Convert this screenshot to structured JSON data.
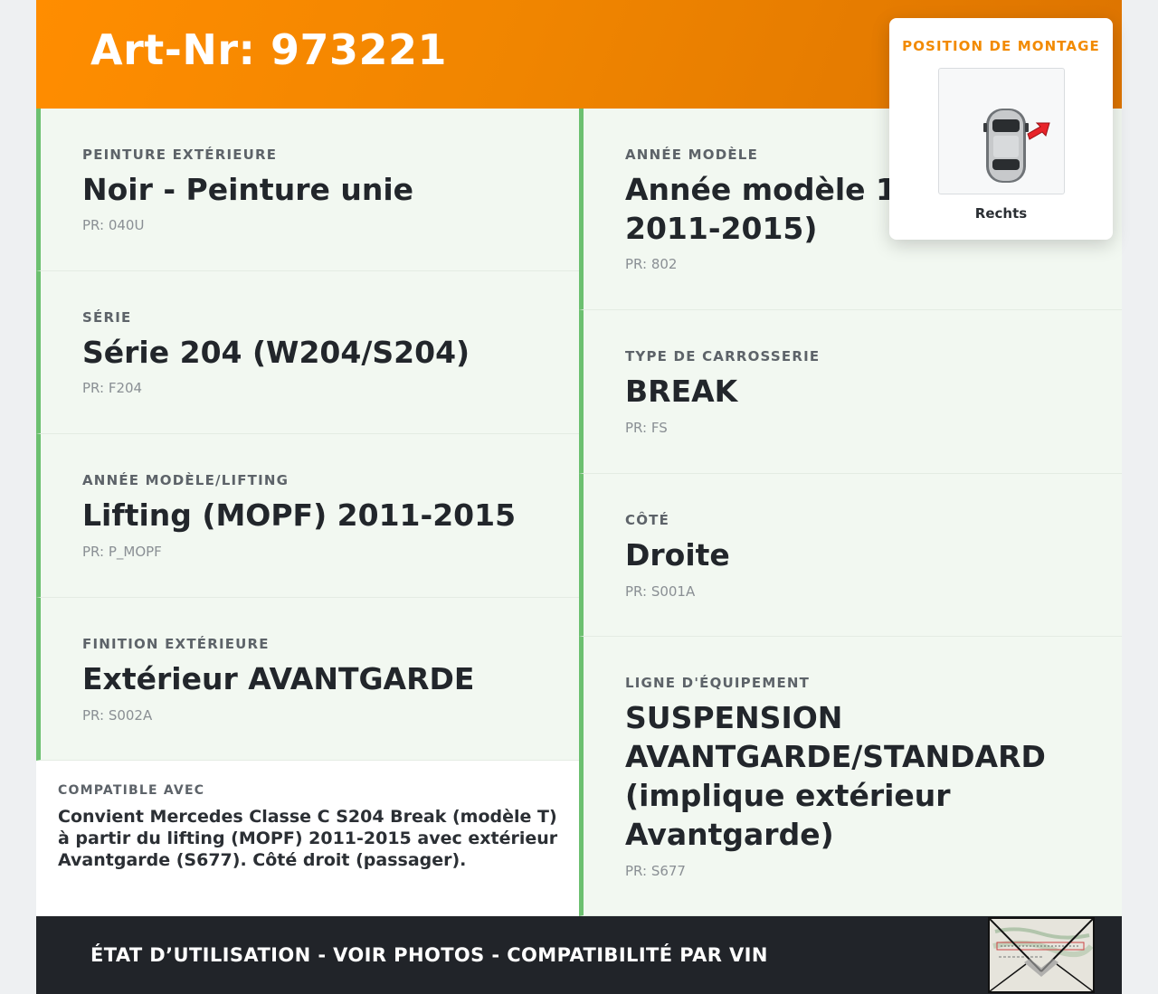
{
  "header": {
    "title": "Art-Nr: 973221"
  },
  "left_cells": [
    {
      "label": "PEINTURE EXTÉRIEURE",
      "value": "Noir - Peinture unie",
      "code": "PR: 040U"
    },
    {
      "label": "SÉRIE",
      "value": "Série 204 (W204/S204)",
      "code": "PR: F204"
    },
    {
      "label": "ANNÉE MODÈLE/LIFTING",
      "value": "Lifting (MOPF) 2011-2015",
      "code": "PR: P_MOPF"
    },
    {
      "label": "FINITION EXTÉRIEURE",
      "value": "Extérieur AVANTGARDE",
      "code": "PR: S002A"
    }
  ],
  "right_cells": [
    {
      "label": "ANNÉE MODÈLE",
      "value": "Année modèle 11/ 2011-2015)",
      "code": "PR: 802"
    },
    {
      "label": "TYPE DE CARROSSERIE",
      "value": "BREAK",
      "code": "PR: FS"
    },
    {
      "label": "CÔTÉ",
      "value": "Droite",
      "code": "PR: S001A"
    },
    {
      "label": "LIGNE D'ÉQUIPEMENT",
      "value": "SUSPENSION AVANTGARDE/STANDARD (implique extérieur Avantgarde)",
      "code": "PR: S677"
    }
  ],
  "compat": {
    "label": "COMPATIBLE AVEC",
    "text": "Convient Mercedes Classe C S204 Break (modèle T) à partir du lifting (MOPF) 2011-2015 avec extérieur Avantgarde (S677). Côté droit (passager)."
  },
  "footer": {
    "text": "ÉTAT D’UTILISATION - VOIR PHOTOS - COMPATIBILITÉ PAR VIN"
  },
  "mount": {
    "title": "POSITION DE MONTAGE",
    "caption": "Rechts"
  },
  "colors": {
    "accent": "#f28a00",
    "green": "#6cc070",
    "dark": "#212429"
  }
}
